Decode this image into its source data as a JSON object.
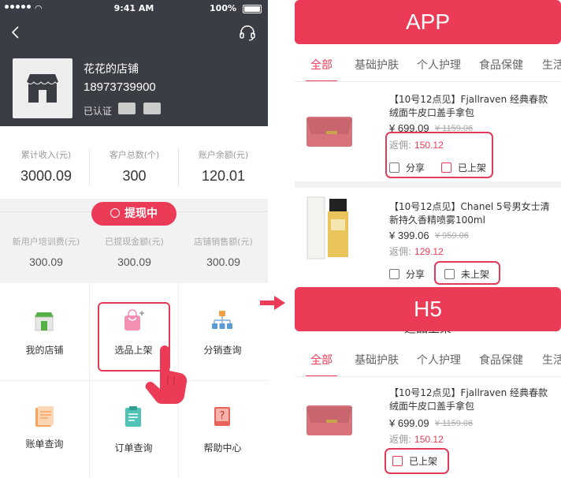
{
  "status_bar": {
    "time": "9:41 AM",
    "battery": "100%"
  },
  "store": {
    "name": "花花的店铺",
    "phone": "18973739900",
    "verified": "已认证"
  },
  "stats": [
    {
      "label": "累计收入(元)",
      "value": "3000.09"
    },
    {
      "label": "客户总数(个)",
      "value": "300"
    },
    {
      "label": "账户余额(元)",
      "value": "120.01"
    }
  ],
  "withdraw": {
    "label": "提现中"
  },
  "sub_stats": [
    {
      "label": "新用户培训费(元)",
      "value": "300.09"
    },
    {
      "label": "已提现金额(元)",
      "value": "300.09"
    },
    {
      "label": "店铺销售额(元)",
      "value": "300.09"
    }
  ],
  "menu": [
    {
      "label": "我的店铺",
      "icon": "shop-icon"
    },
    {
      "label": "选品上架",
      "icon": "shopping-bag-add-icon"
    },
    {
      "label": "分销查询",
      "icon": "org-chart-icon"
    },
    {
      "label": "账单查询",
      "icon": "bill-icon"
    },
    {
      "label": "订单查询",
      "icon": "clipboard-icon"
    },
    {
      "label": "帮助中心",
      "icon": "help-book-icon"
    }
  ],
  "app_section": {
    "banner": "APP"
  },
  "h5_section": {
    "banner": "H5",
    "page_title": "选品上架"
  },
  "tabs": [
    "全部",
    "基础护肤",
    "个人护理",
    "食品保健",
    "生活"
  ],
  "products": [
    {
      "title": "【10号12点见】Fjallraven 经典春款绒面牛皮口盖手拿包",
      "price": "¥ 699.09",
      "old_price": "¥ 1159.06",
      "commission_label": "返佣:",
      "commission": "150.12",
      "share": "分享",
      "status": "已上架"
    },
    {
      "title": "【10号12点见】Chanel 5号男女士清新持久香精喷雾100ml",
      "price": "¥ 399.06",
      "old_price": "¥ 959.06",
      "commission_label": "返佣:",
      "commission": "129.12",
      "share": "分享",
      "status": "未上架"
    },
    {
      "title": "【10号12点见】Fjallraven 经典春款绒面牛皮口盖手拿包",
      "price": "¥ 699.09",
      "old_price": "¥ 1159.06",
      "commission_label": "返佣:",
      "commission": "150.12",
      "status": "已上架"
    }
  ],
  "colors": {
    "accent": "#ec3b57",
    "header_bg": "#3b3d44",
    "grey_bg": "#f2f2f2"
  }
}
